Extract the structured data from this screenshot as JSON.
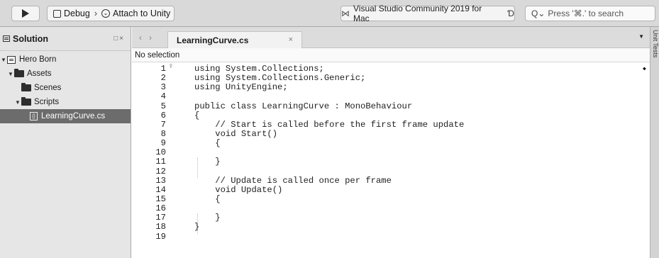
{
  "toolbar": {
    "config": {
      "debug_label": "Debug",
      "separator": "›",
      "target_label": "Attach to Unity"
    },
    "status": {
      "text": "Visual Studio Community 2019 for Mac"
    },
    "search": {
      "placeholder": "Press '⌘.' to search"
    }
  },
  "solution_pane": {
    "title": "Solution",
    "tree": [
      {
        "label": "Hero Born",
        "type": "project",
        "expanded": true
      },
      {
        "label": "Assets",
        "type": "folder",
        "expanded": true
      },
      {
        "label": "Scenes",
        "type": "folder",
        "expanded": false
      },
      {
        "label": "Scripts",
        "type": "folder",
        "expanded": true
      },
      {
        "label": "LearningCurve.cs",
        "type": "file",
        "selected": true
      }
    ]
  },
  "editor": {
    "tab": {
      "label": "LearningCurve.cs"
    },
    "navbar_text": "No selection",
    "right_strip_label": "Unit Tests",
    "lines": [
      {
        "n": "1",
        "text": "using System.Collections;"
      },
      {
        "n": "2",
        "text": "using System.Collections.Generic;"
      },
      {
        "n": "3",
        "text": "using UnityEngine;"
      },
      {
        "n": "4",
        "text": ""
      },
      {
        "n": "5",
        "text": "public class LearningCurve : MonoBehaviour"
      },
      {
        "n": "6",
        "text": "{"
      },
      {
        "n": "7",
        "text": "    // Start is called before the first frame update"
      },
      {
        "n": "8",
        "text": "    void Start()"
      },
      {
        "n": "9",
        "text": "    {"
      },
      {
        "n": "10",
        "text": ""
      },
      {
        "n": "11",
        "text": "    }"
      },
      {
        "n": "12",
        "text": ""
      },
      {
        "n": "13",
        "text": "    // Update is called once per frame"
      },
      {
        "n": "14",
        "text": "    void Update()"
      },
      {
        "n": "15",
        "text": "    {"
      },
      {
        "n": "16",
        "text": ""
      },
      {
        "n": "17",
        "text": "    }"
      },
      {
        "n": "18",
        "text": "}"
      },
      {
        "n": "19",
        "text": ""
      }
    ]
  }
}
